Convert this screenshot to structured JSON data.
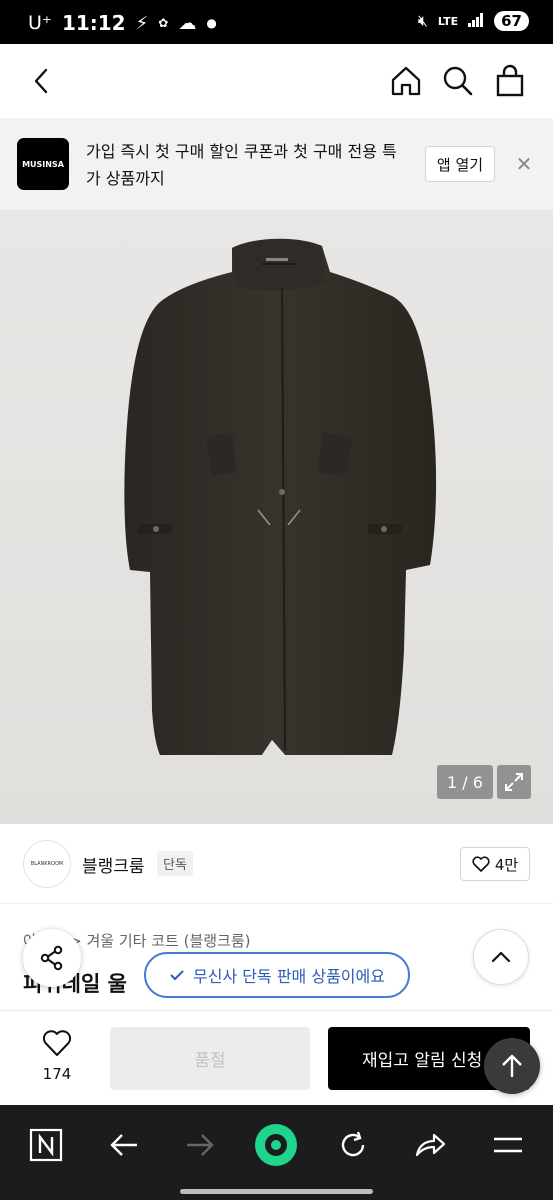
{
  "status_bar": {
    "carrier": "U⁺",
    "time": "11:12",
    "battery": "67"
  },
  "promo": {
    "logo_text": "MUSINSA",
    "message": "가입 즉시 첫 구매 할인 쿠폰과 첫 구매 전용 특가 상품까지",
    "open_app_label": "앱 열기",
    "close_symbol": "✕"
  },
  "image": {
    "counter": "1 / 6"
  },
  "brand": {
    "logo_text": "BLANKROOM",
    "name": "블랭크룸",
    "tag": "단독",
    "like_count": "4만"
  },
  "product": {
    "breadcrumb": "아우터 > 겨울 기타 코트 (블랭크룸)",
    "title": "피쉬테일 울",
    "exclusive_notice": "무신사 단독 판매 상품이에요"
  },
  "actions": {
    "wish_count": "174",
    "soldout_label": "품절",
    "restock_label": "재입고 알림 신청"
  },
  "colors": {
    "accent_blue": "#2b5bb8",
    "primary_black": "#000000",
    "browser_bar": "#1c1c1e",
    "browser_home": "#1fd48b"
  }
}
